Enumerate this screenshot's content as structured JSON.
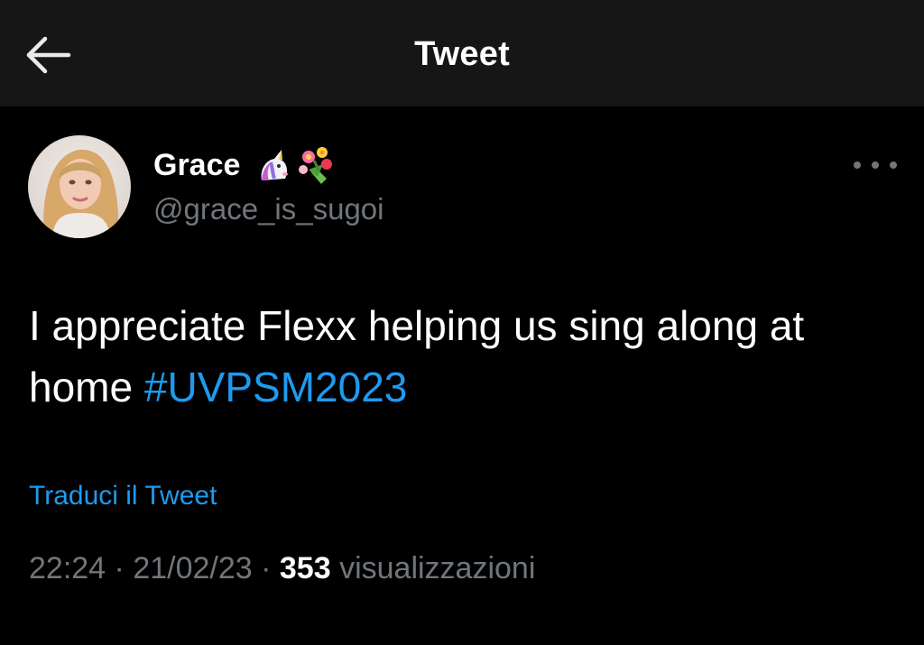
{
  "header": {
    "title": "Tweet",
    "back_icon": "arrow-left-icon",
    "background": "#161616"
  },
  "author": {
    "display_name": "Grace",
    "handle": "@grace_is_sugoi",
    "name_emojis": [
      "unicorn-emoji",
      "bouquet-emoji"
    ],
    "avatar_icon": "profile-avatar"
  },
  "more_icon": "more-horizontal-icon",
  "tweet": {
    "text": "I appreciate Flexx helping us sing along at home ",
    "hashtag": "#UVPSM2023"
  },
  "translate_label": "Traduci il Tweet",
  "meta": {
    "time": "22:24",
    "separator": " · ",
    "date": "21/02/23",
    "views_count": "353",
    "views_label": "visualizzazioni"
  },
  "colors": {
    "background": "#000000",
    "accent": "#1d9bf0",
    "secondary_text": "#71767b",
    "primary_text": "#ffffff"
  }
}
